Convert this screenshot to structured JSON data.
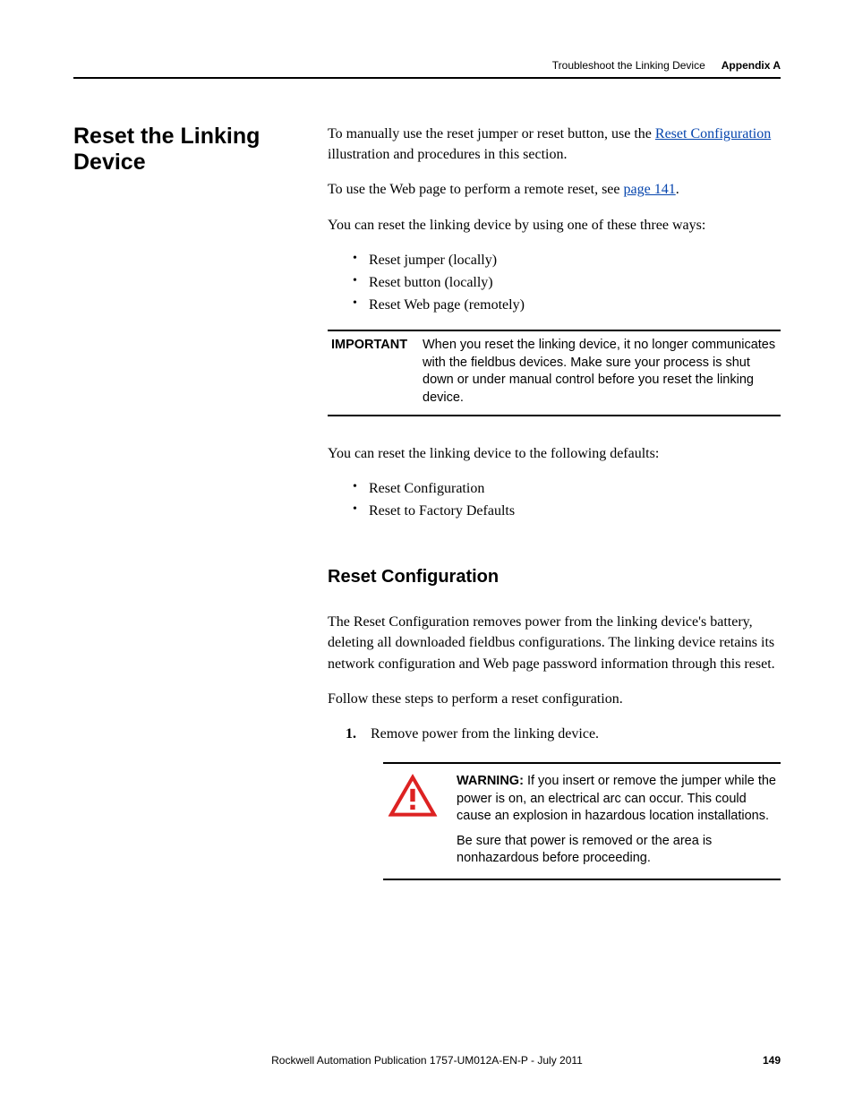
{
  "header": {
    "left": "Troubleshoot the Linking Device",
    "right": "Appendix A"
  },
  "side_heading": "Reset the Linking Device",
  "intro": {
    "p1a": "To manually use the reset jumper or reset button, use the ",
    "p1link": "Reset Configuration",
    "p1b": " illustration and procedures in this section.",
    "p2a": "To use the Web page to perform a remote reset, see ",
    "p2link": "page 141",
    "p2b": ".",
    "p3": "You can reset the linking device by using one of these three ways:"
  },
  "ways": [
    "Reset jumper (locally)",
    "Reset button (locally)",
    "Reset Web page (remotely)"
  ],
  "important": {
    "label": "IMPORTANT",
    "text": "When you reset the linking device, it no longer communicates with the fieldbus devices. Make sure your process is shut down or under manual control before you reset the linking device."
  },
  "defaults_intro": "You can reset the linking device to the following defaults:",
  "defaults": [
    "Reset Configuration",
    "Reset to Factory Defaults"
  ],
  "subheading": "Reset Configuration",
  "reset_config_p1": "The Reset Configuration removes power from the linking device's battery, deleting all downloaded fieldbus configurations. The linking device retains its network configuration and Web page password information through this reset.",
  "reset_config_p2": "Follow these steps to perform a reset configuration.",
  "steps": {
    "num1": "1.",
    "text1": "Remove power from the linking device."
  },
  "warning": {
    "label": "WARNING: ",
    "t1": "If you insert or remove the jumper while the power is on, an electrical arc can occur. This could cause an explosion in hazardous location installations.",
    "t2": "Be sure that power is removed or the area is nonhazardous before proceeding."
  },
  "footer": {
    "pub": "Rockwell Automation Publication 1757-UM012A-EN-P - July 2011",
    "page": "149"
  }
}
